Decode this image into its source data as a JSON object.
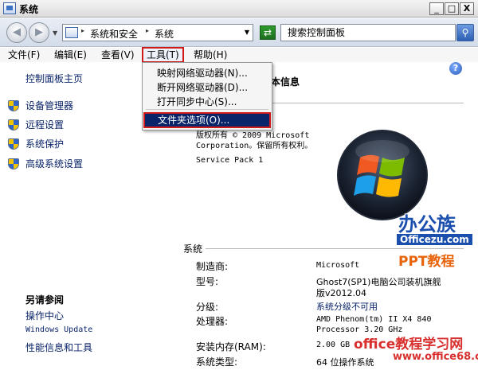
{
  "window": {
    "title": "系统",
    "minimize": "_",
    "maximize": "□",
    "close": "X"
  },
  "navigation": {
    "back_glyph": "◀",
    "forward_glyph": "▶",
    "address": {
      "crumbs": [
        "系统和安全",
        "系统"
      ],
      "separator": "▸",
      "dropdown_glyph": "▼"
    },
    "refresh_glyph": "⇄",
    "search": {
      "placeholder": "搜索控制面板"
    },
    "search_glyph": "⚲"
  },
  "menubar": {
    "file": "文件(F)",
    "edit": "编辑(E)",
    "view": "查看(V)",
    "tools": "工具(T)",
    "help": "帮助(H)"
  },
  "tools_menu": {
    "items": [
      "映射网络驱动器(N)...",
      "断开网络驱动器(D)...",
      "打开同步中心(S)..."
    ],
    "highlighted": "文件夹选项(O)..."
  },
  "sidebar": {
    "home": "控制面板主页",
    "items": [
      "设备管理器",
      "远程设置",
      "系统保护",
      "高级系统设置"
    ]
  },
  "see_also": {
    "title": "另请参阅",
    "items": [
      "操作中心",
      "Windows Update",
      "性能信息和工具"
    ]
  },
  "help_glyph": "?",
  "main": {
    "section_heading_fragment": "本信息",
    "copyright_line1": "版权所有 © 2009 Microsoft",
    "copyright_line2": "Corporation。保留所有权利。",
    "service_pack": "Service Pack 1",
    "system_section": "系统",
    "rows": [
      {
        "label": "制造商:",
        "value": "Microsoft"
      },
      {
        "label": "型号:",
        "value_line1": "Ghost7(SP1)电脑公司装机旗舰",
        "value_line2": "版v2012.04"
      },
      {
        "label": "分级:",
        "value": "系统分级不可用"
      },
      {
        "label": "处理器:",
        "value_line1": "AMD Phenom(tm) II X4 840",
        "value_line2": "Processor   3.20 GHz"
      },
      {
        "label": "安装内存(RAM):",
        "value": "2.00 GB"
      },
      {
        "label": "系统类型:",
        "value": "64 位操作系统"
      }
    ]
  },
  "watermarks": {
    "brand": "办公族",
    "domain": "Officezu.com",
    "ppt": "PPT教程",
    "site": "office教程学习网",
    "url": "www.office68.com"
  }
}
